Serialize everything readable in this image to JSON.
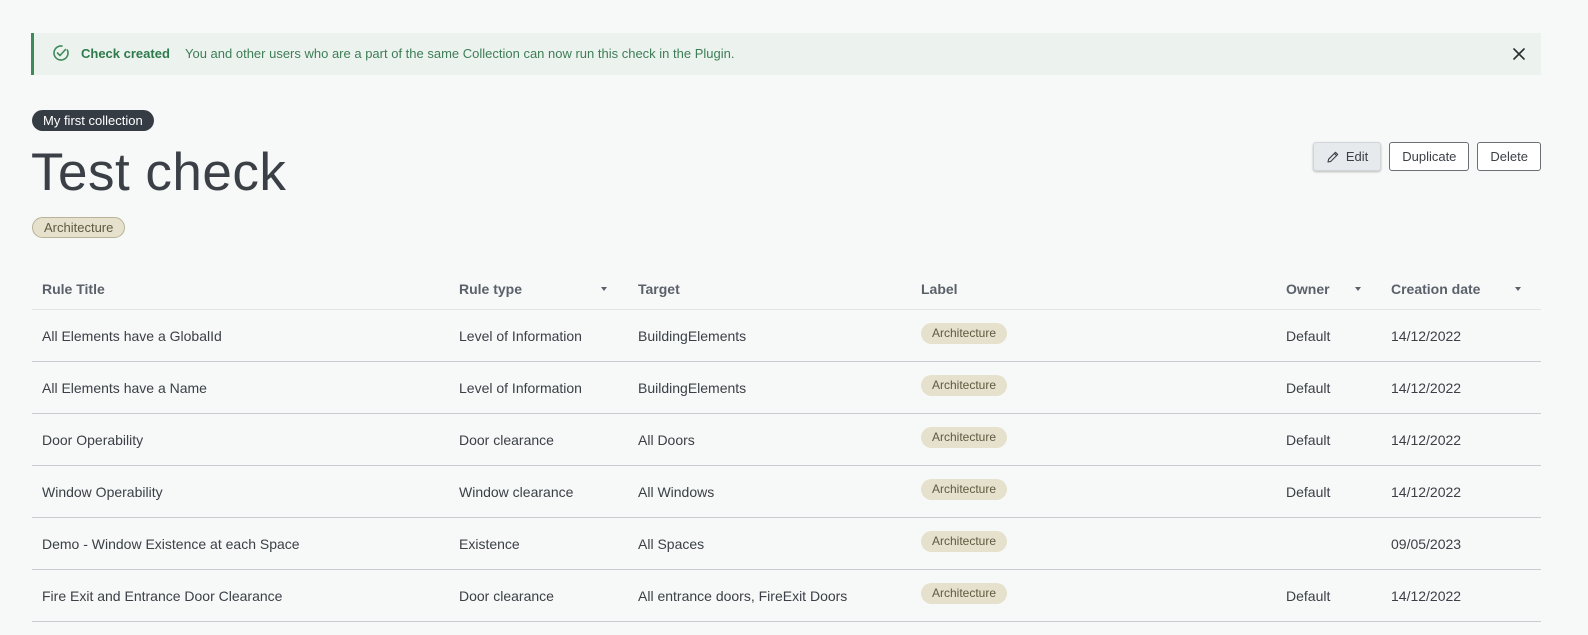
{
  "banner": {
    "title": "Check created",
    "message": "You and other users who are a part of the same Collection can now run this check in the Plugin."
  },
  "collection": "My first collection",
  "page": {
    "title": "Test check",
    "tag": "Architecture"
  },
  "actions": {
    "edit": "Edit",
    "duplicate": "Duplicate",
    "delete": "Delete"
  },
  "table": {
    "headers": {
      "rule_title": "Rule Title",
      "rule_type": "Rule type",
      "target": "Target",
      "label": "Label",
      "owner": "Owner",
      "creation_date": "Creation date"
    },
    "rows": [
      {
        "title": "All Elements have a GlobalId",
        "type": "Level of Information",
        "target": "BuildingElements",
        "label": "Architecture",
        "owner": "Default",
        "date": "14/12/2022"
      },
      {
        "title": "All Elements have a Name",
        "type": "Level of Information",
        "target": "BuildingElements",
        "label": "Architecture",
        "owner": "Default",
        "date": "14/12/2022"
      },
      {
        "title": "Door Operability",
        "type": "Door clearance",
        "target": "All Doors",
        "label": "Architecture",
        "owner": "Default",
        "date": "14/12/2022"
      },
      {
        "title": "Window Operability",
        "type": "Window clearance",
        "target": "All Windows",
        "label": "Architecture",
        "owner": "Default",
        "date": "14/12/2022"
      },
      {
        "title": "Demo - Window Existence at each Space",
        "type": "Existence",
        "target": "All Spaces",
        "label": "Architecture",
        "owner": "",
        "date": "09/05/2023"
      },
      {
        "title": "Fire Exit and Entrance Door Clearance",
        "type": "Door clearance",
        "target": "All entrance doors, FireExit Doors",
        "label": "Architecture",
        "owner": "Default",
        "date": "14/12/2022"
      }
    ]
  },
  "colors": {
    "accent_green": "#3f8a5a",
    "tag_bg": "#e6e1cd",
    "pill_bg": "#353c44"
  }
}
